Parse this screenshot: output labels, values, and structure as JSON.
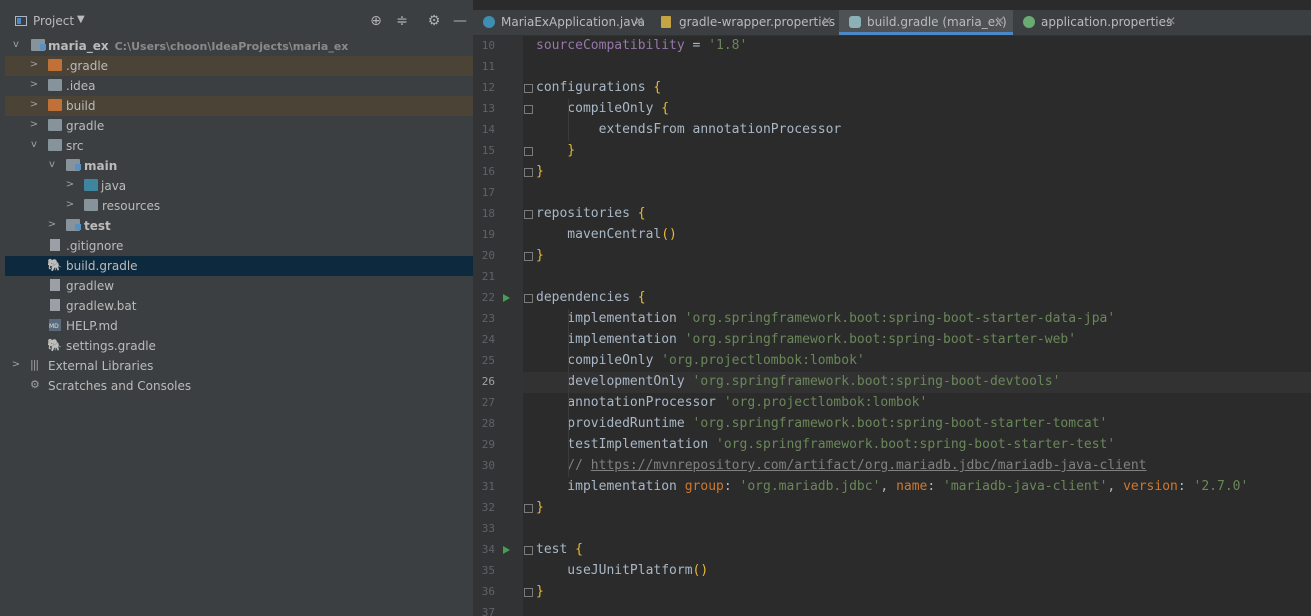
{
  "project_panel": {
    "title": "Project",
    "tree": [
      {
        "label": "maria_ex",
        "path": "C:\\Users\\choon\\IdeaProjects\\maria_ex",
        "icon": "module-folder-icon"
      },
      {
        "label": ".gradle",
        "icon": "folder-icon"
      },
      {
        "label": ".idea",
        "icon": "folder-icon"
      },
      {
        "label": "build",
        "icon": "folder-icon"
      },
      {
        "label": "gradle",
        "icon": "folder-icon"
      },
      {
        "label": "src",
        "icon": "folder-icon"
      },
      {
        "label": "main",
        "icon": "module-folder-icon"
      },
      {
        "label": "java",
        "icon": "source-folder-icon"
      },
      {
        "label": "resources",
        "icon": "resources-folder-icon"
      },
      {
        "label": "test",
        "icon": "module-folder-icon"
      },
      {
        "label": ".gitignore",
        "icon": "file-icon"
      },
      {
        "label": "build.gradle",
        "icon": "gradle-icon"
      },
      {
        "label": "gradlew",
        "icon": "script-icon"
      },
      {
        "label": "gradlew.bat",
        "icon": "file-icon"
      },
      {
        "label": "HELP.md",
        "icon": "markdown-icon"
      },
      {
        "label": "settings.gradle",
        "icon": "gradle-icon"
      },
      {
        "label": "External Libraries",
        "icon": "libraries-icon"
      },
      {
        "label": "Scratches and Consoles",
        "icon": "scratches-icon"
      }
    ]
  },
  "tabs": [
    {
      "label": "MariaExApplication.java",
      "icon": "java-class-icon"
    },
    {
      "label": "gradle-wrapper.properties",
      "icon": "properties-icon"
    },
    {
      "label": "build.gradle (maria_ex)",
      "icon": "gradle-icon"
    },
    {
      "label": "application.properties",
      "icon": "spring-properties-icon"
    }
  ],
  "editor": {
    "line_numbers": [
      "10",
      "11",
      "12",
      "13",
      "14",
      "15",
      "16",
      "17",
      "18",
      "19",
      "20",
      "21",
      "22",
      "23",
      "24",
      "25",
      "26",
      "27",
      "28",
      "29",
      "30",
      "31",
      "32",
      "33",
      "34",
      "35",
      "36",
      "37"
    ],
    "current_line": "26",
    "lines": [
      [
        [
          "prop",
          "sourceCompatibility"
        ],
        [
          "id",
          " = "
        ],
        [
          "str",
          "'1.8'"
        ]
      ],
      [],
      [
        [
          "id",
          "configurations "
        ],
        [
          "br",
          "{"
        ]
      ],
      [
        [
          "id",
          "    compileOnly "
        ],
        [
          "br",
          "{"
        ]
      ],
      [
        [
          "id",
          "        extendsFrom annotationProcessor"
        ]
      ],
      [
        [
          "br",
          "    }"
        ]
      ],
      [
        [
          "br",
          "}"
        ]
      ],
      [],
      [
        [
          "id",
          "repositories "
        ],
        [
          "br",
          "{"
        ]
      ],
      [
        [
          "id",
          "    mavenCentral"
        ],
        [
          "br",
          "()"
        ]
      ],
      [
        [
          "br",
          "}"
        ]
      ],
      [],
      [
        [
          "id",
          "dependencies "
        ],
        [
          "br",
          "{"
        ]
      ],
      [
        [
          "id",
          "    implementation "
        ],
        [
          "str",
          "'org.springframework.boot:spring-boot-starter-data-jpa'"
        ]
      ],
      [
        [
          "id",
          "    implementation "
        ],
        [
          "str",
          "'org.springframework.boot:spring-boot-starter-web'"
        ]
      ],
      [
        [
          "id",
          "    compileOnly "
        ],
        [
          "str",
          "'org.projectlombok:lombok'"
        ]
      ],
      [
        [
          "id",
          "    developmentOnly "
        ],
        [
          "str",
          "'org.springframework.boot:spring-boot-devtools'"
        ]
      ],
      [
        [
          "id",
          "    annotationProcessor "
        ],
        [
          "str",
          "'org.projectlombok:lombok'"
        ]
      ],
      [
        [
          "id",
          "    providedRuntime "
        ],
        [
          "str",
          "'org.springframework.boot:spring-boot-starter-tomcat'"
        ]
      ],
      [
        [
          "id",
          "    testImplementation "
        ],
        [
          "str",
          "'org.springframework.boot:spring-boot-starter-test'"
        ]
      ],
      [
        [
          "cmt",
          "    // "
        ],
        [
          "url",
          "https://mvnrepository.com/artifact/org.mariadb.jdbc/mariadb-java-client"
        ]
      ],
      [
        [
          "id",
          "    implementation "
        ],
        [
          "param",
          "group"
        ],
        [
          "id",
          ": "
        ],
        [
          "str",
          "'org.mariadb.jdbc'"
        ],
        [
          "id",
          ", "
        ],
        [
          "param",
          "name"
        ],
        [
          "id",
          ": "
        ],
        [
          "str",
          "'mariadb-java-client'"
        ],
        [
          "id",
          ", "
        ],
        [
          "param",
          "version"
        ],
        [
          "id",
          ": "
        ],
        [
          "str",
          "'2.7.0'"
        ]
      ],
      [
        [
          "br",
          "}"
        ]
      ],
      [],
      [
        [
          "id",
          "test "
        ],
        [
          "br",
          "{"
        ]
      ],
      [
        [
          "id",
          "    useJUnitPlatform"
        ],
        [
          "br",
          "()"
        ]
      ],
      [
        [
          "br",
          "}"
        ]
      ],
      []
    ]
  },
  "colors": {
    "string": "#6a8759",
    "brace": "#e8ba36",
    "property": "#9876aa",
    "param": "#cc7832",
    "comment": "#808080",
    "selection": "#0d293e",
    "highlight": "#4a4336"
  }
}
